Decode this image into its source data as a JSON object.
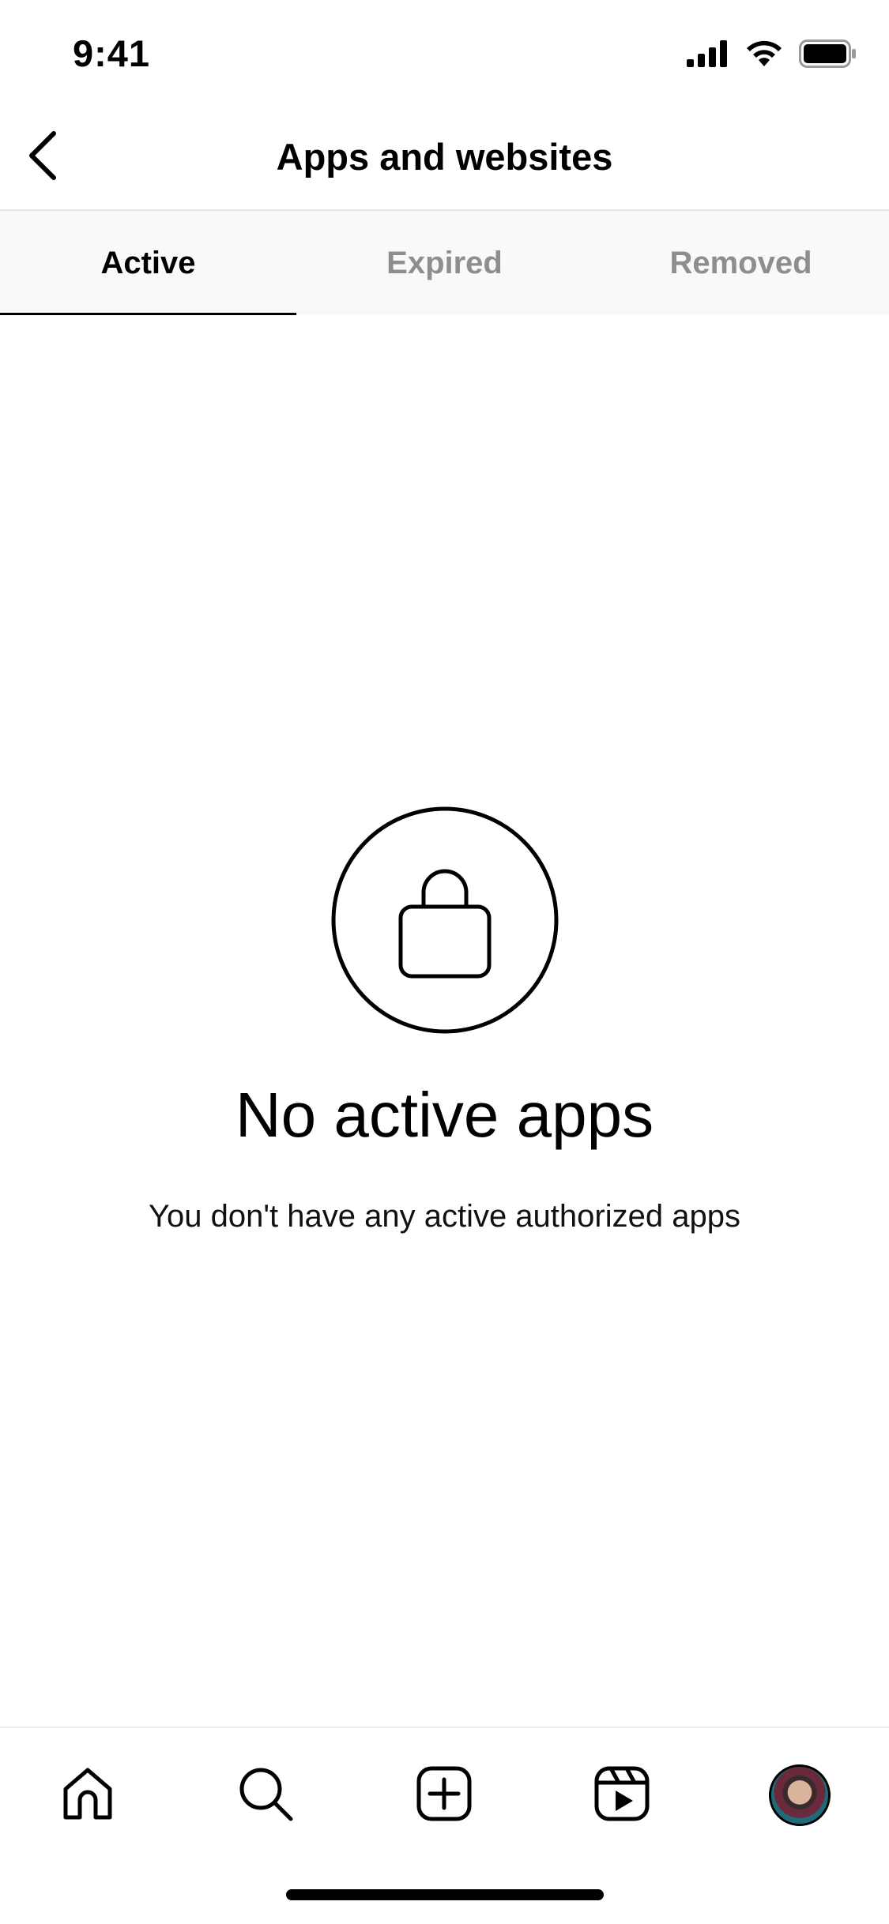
{
  "status_bar": {
    "time": "9:41",
    "icons": [
      "cellular-signal-icon",
      "wifi-icon",
      "battery-icon"
    ]
  },
  "header": {
    "title": "Apps and websites",
    "back_icon": "chevron-left-icon"
  },
  "tabs": [
    {
      "label": "Active",
      "selected": true
    },
    {
      "label": "Expired",
      "selected": false
    },
    {
      "label": "Removed",
      "selected": false
    }
  ],
  "empty_state": {
    "icon": "lock-icon",
    "title": "No active apps",
    "subtitle": "You don't have any active authorized apps"
  },
  "bottom_nav": {
    "items": [
      "home-icon",
      "search-icon",
      "create-post-icon",
      "reels-icon",
      "profile-avatar"
    ]
  },
  "colors": {
    "text_primary": "#000000",
    "text_secondary": "#8e8e8e",
    "tab_background": "#f9f9f9",
    "divider": "#e6e6e6"
  }
}
